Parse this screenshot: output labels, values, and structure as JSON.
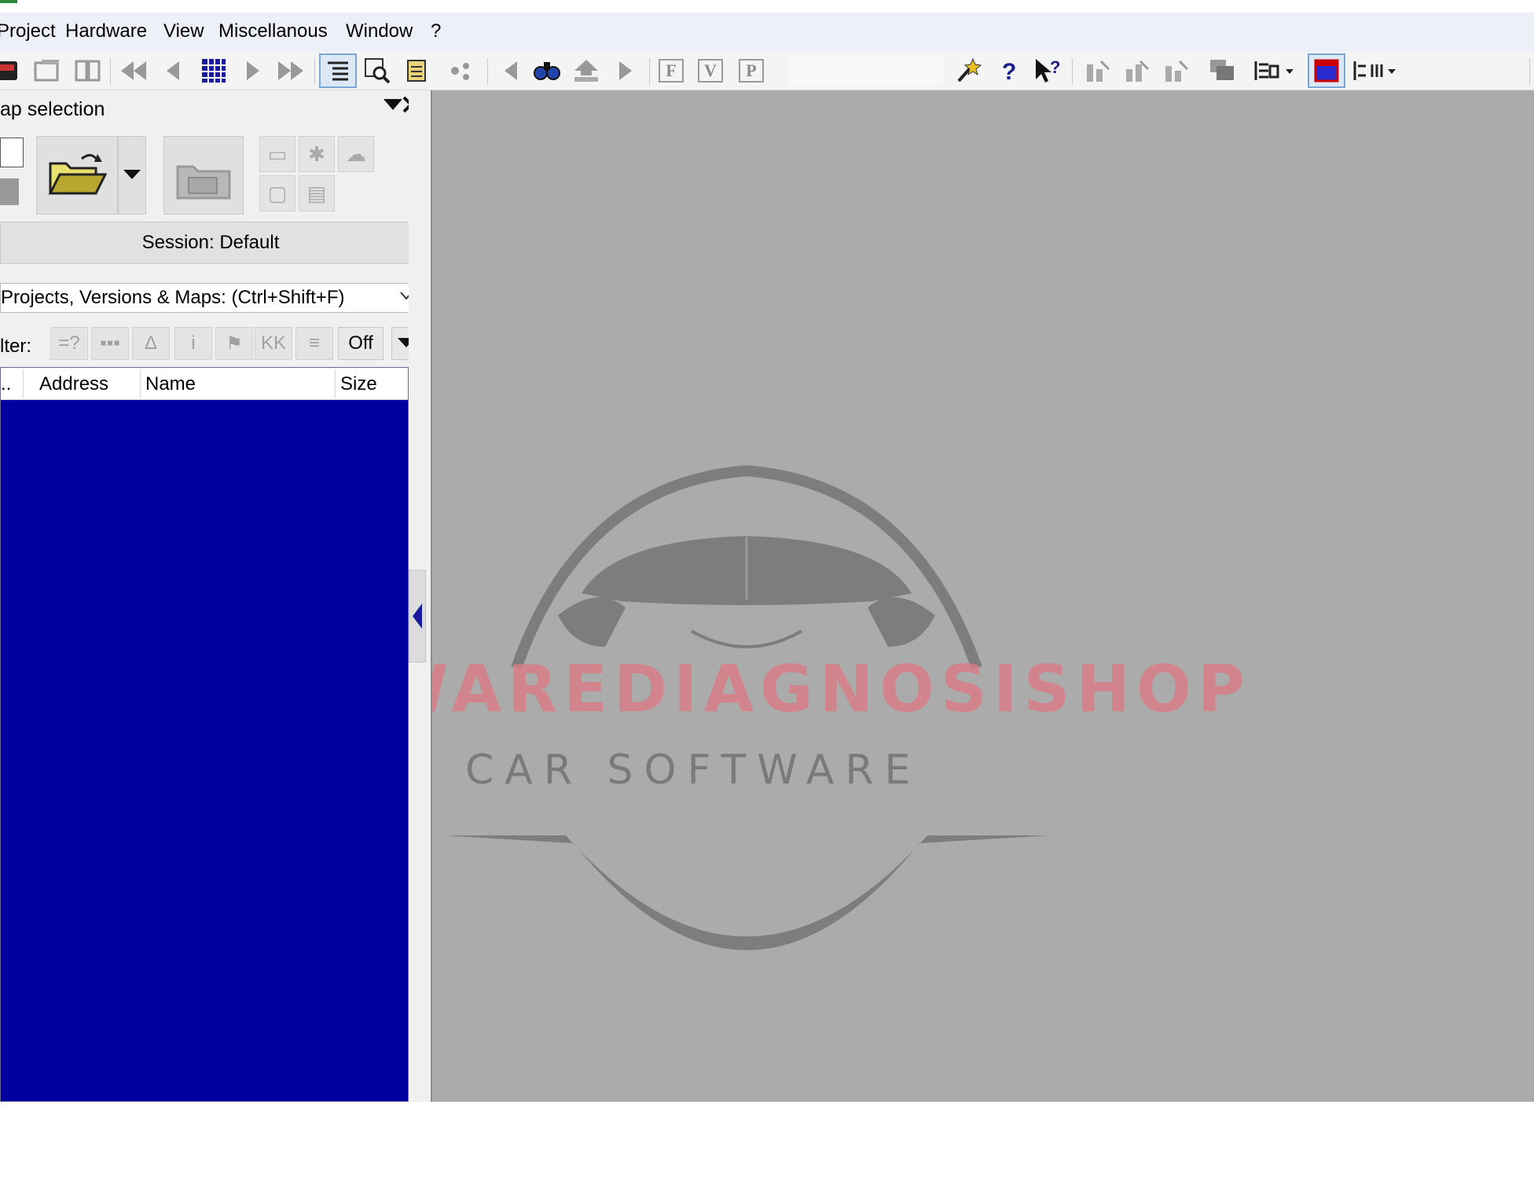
{
  "menu": {
    "items": [
      "Project",
      "Hardware",
      "View",
      "Miscellanous",
      "Window",
      "?"
    ]
  },
  "toolbar": {
    "letters": [
      "F",
      "V",
      "P"
    ]
  },
  "panel": {
    "title": "ap selection",
    "session_label": "Session: Default",
    "search_combo": "Projects, Versions & Maps:  (Ctrl+Shift+F)",
    "filter_label": "lter:",
    "filter_buttons": [
      "=?",
      "▪▪▪",
      "Δ",
      "i",
      "⚑",
      "KK",
      "≡"
    ],
    "off_label": "Off"
  },
  "table": {
    "columns": [
      "..",
      "Address",
      "Name",
      "Size"
    ],
    "rows": []
  },
  "watermark": {
    "brand": "SOFTWAREDIAGNOSISHOP",
    "tagline": "CAR SOFTWARE"
  },
  "colors": {
    "list_background": "#0000a0",
    "workspace": "#ababab",
    "menubar": "#eef0f8"
  }
}
